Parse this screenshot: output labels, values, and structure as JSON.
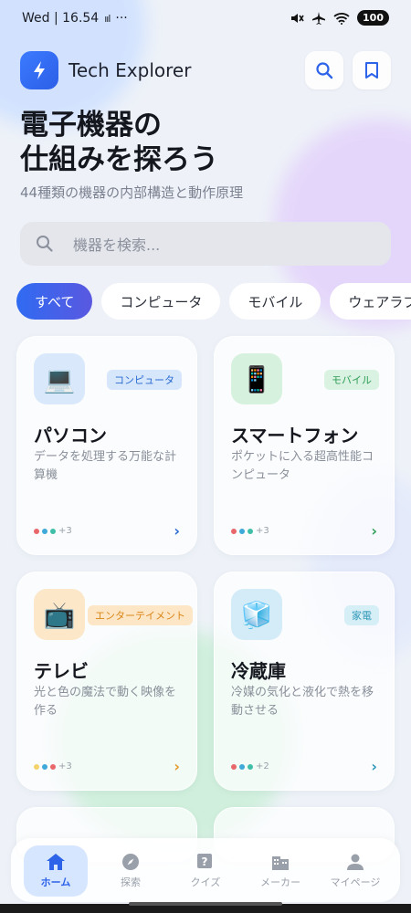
{
  "status": {
    "time": "Wed | 16.54",
    "battery": "100"
  },
  "app": {
    "title": "Tech Explorer"
  },
  "hero": {
    "title_line1": "電子機器の",
    "title_line2": "仕組みを探ろう",
    "subtitle": "44種類の機器の内部構造と動作原理"
  },
  "search": {
    "placeholder": "機器を検索..."
  },
  "chips": [
    "すべて",
    "コンピュータ",
    "モバイル",
    "ウェアラブル"
  ],
  "cards": [
    {
      "name": "パソコン",
      "category": "コンピュータ",
      "desc": "データを処理する万能な計算機",
      "more": "+3",
      "emoji": "💻",
      "icon_bg": "#d9e8fb",
      "badge_bg": "#d6e6fb",
      "badge_color": "#2a6bd1",
      "arrow_color": "#2a6bd1",
      "dots": [
        "#e8676b",
        "#3fa9d9",
        "#3fbfa8"
      ]
    },
    {
      "name": "スマートフォン",
      "category": "モバイル",
      "desc": "ポケットに入る超高性能コンピュータ",
      "more": "+3",
      "emoji": "📱",
      "icon_bg": "#d7f1df",
      "badge_bg": "#d9f2e1",
      "badge_color": "#2f9e57",
      "arrow_color": "#2f9e57",
      "dots": [
        "#e8676b",
        "#3fa9d9",
        "#3fbfa8"
      ]
    },
    {
      "name": "テレビ",
      "category": "エンターテイメント",
      "desc": "光と色の魔法で動く映像を作る",
      "more": "+3",
      "emoji": "📺",
      "icon_bg": "#fde7c9",
      "badge_bg": "#fde6c6",
      "badge_color": "#d98516",
      "arrow_color": "#e39a2a",
      "dots": [
        "#f3d36a",
        "#3fa9d9",
        "#e8676b"
      ]
    },
    {
      "name": "冷蔵庫",
      "category": "家電",
      "desc": "冷媒の気化と液化で熱を移動させる",
      "more": "+2",
      "emoji": "🧊",
      "icon_bg": "#d4ecf7",
      "badge_bg": "#d6eef6",
      "badge_color": "#2f98b8",
      "arrow_color": "#2f98b8",
      "dots": [
        "#e8676b",
        "#3fa9d9",
        "#3fbfa8"
      ]
    }
  ],
  "nav": [
    {
      "label": "ホーム",
      "icon": "home-icon",
      "active": true
    },
    {
      "label": "探索",
      "icon": "compass-icon",
      "active": false
    },
    {
      "label": "クイズ",
      "icon": "quiz-icon",
      "active": false
    },
    {
      "label": "メーカー",
      "icon": "building-icon",
      "active": false
    },
    {
      "label": "マイページ",
      "icon": "person-icon",
      "active": false
    }
  ]
}
